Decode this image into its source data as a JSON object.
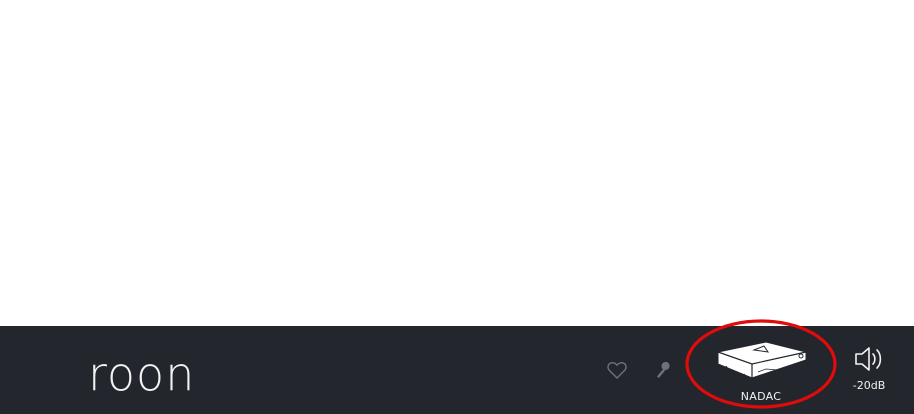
{
  "app": {
    "logo_text": "roon"
  },
  "footer": {
    "favorite_icon": "heart-outline-icon",
    "radio_icon": "microphone-icon",
    "zone": {
      "name": "NADAC",
      "device_icon": "dac-device-icon"
    },
    "volume": {
      "icon": "speaker-volume-icon",
      "level": "-20dB"
    }
  },
  "annotation": {
    "shape": "ellipse",
    "color": "#e00b0b"
  },
  "colors": {
    "footer_background": "#23262d",
    "content_background": "#ffffff",
    "footer_text": "#f2f2f2",
    "inactive_icon": "#6f7278",
    "annotation": "#e00b0b"
  }
}
